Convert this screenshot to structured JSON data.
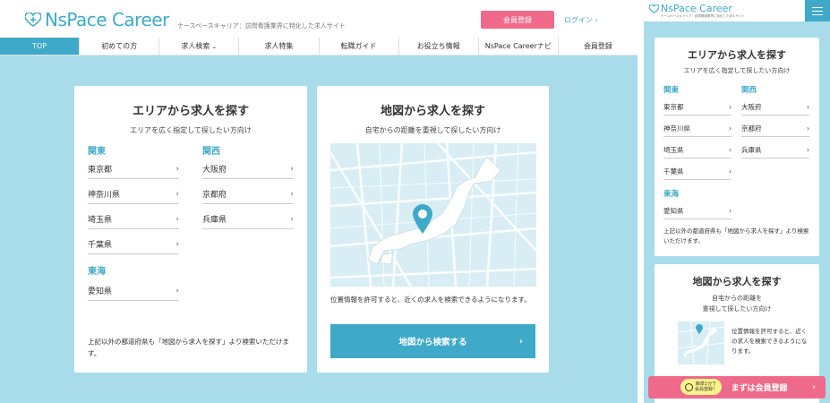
{
  "header": {
    "logo": "NsPace Career",
    "tagline": "ナースペースキャリア：訪問看護業界に特化した求人サイト",
    "register_label": "会員登録",
    "login_label": "ログイン"
  },
  "nav": [
    "TOP",
    "初めての方",
    "求人検索",
    "求人特集",
    "転職ガイド",
    "お役立ち情報",
    "NsPace Careerナビ",
    "会員登録"
  ],
  "area_card": {
    "title": "エリアから求人を探す",
    "subtitle": "エリアを広く指定して探したい方向け",
    "regions": [
      {
        "name": "関東",
        "prefs": [
          "東京都",
          "神奈川県",
          "埼玉県",
          "千葉県"
        ]
      },
      {
        "name": "関西",
        "prefs": [
          "大阪府",
          "京都府",
          "兵庫県"
        ]
      },
      {
        "name": "東海",
        "prefs": [
          "愛知県"
        ]
      }
    ],
    "note": "上記以外の都道府県も「地図から求人を探す」より検索いただけます。"
  },
  "map_card": {
    "title": "地図から求人を探す",
    "subtitle": "自宅からの距離を重視して探したい方向け",
    "note": "位置情報を許可すると、近くの求人を検索できるようになります。",
    "button_label": "地図から検索する"
  },
  "mobile": {
    "logo": "NsPace Career",
    "tagline": "ナースペースキャリア：訪問看護業界に特化した求人サイト",
    "area_title": "エリアから求人を探す",
    "area_subtitle": "エリアを広く指定して探したい方向け",
    "area_note": "上記以外の都道府県も「地図から求人を探す」より検索いただけます。",
    "map_title": "地図から求人を探す",
    "map_subtitle_1": "自宅からの距離を",
    "map_subtitle_2": "重視して探したい方向け",
    "map_note": "位置情報を許可すると、近くの求人を検索できるようになります。",
    "cta_badge_1": "簡単1分で",
    "cta_badge_2": "会員登録！",
    "cta_label": "まずは会員登録"
  },
  "colors": {
    "accent": "#3fa9c9",
    "background": "#a8dcea",
    "cta": "#ef6a8a"
  }
}
